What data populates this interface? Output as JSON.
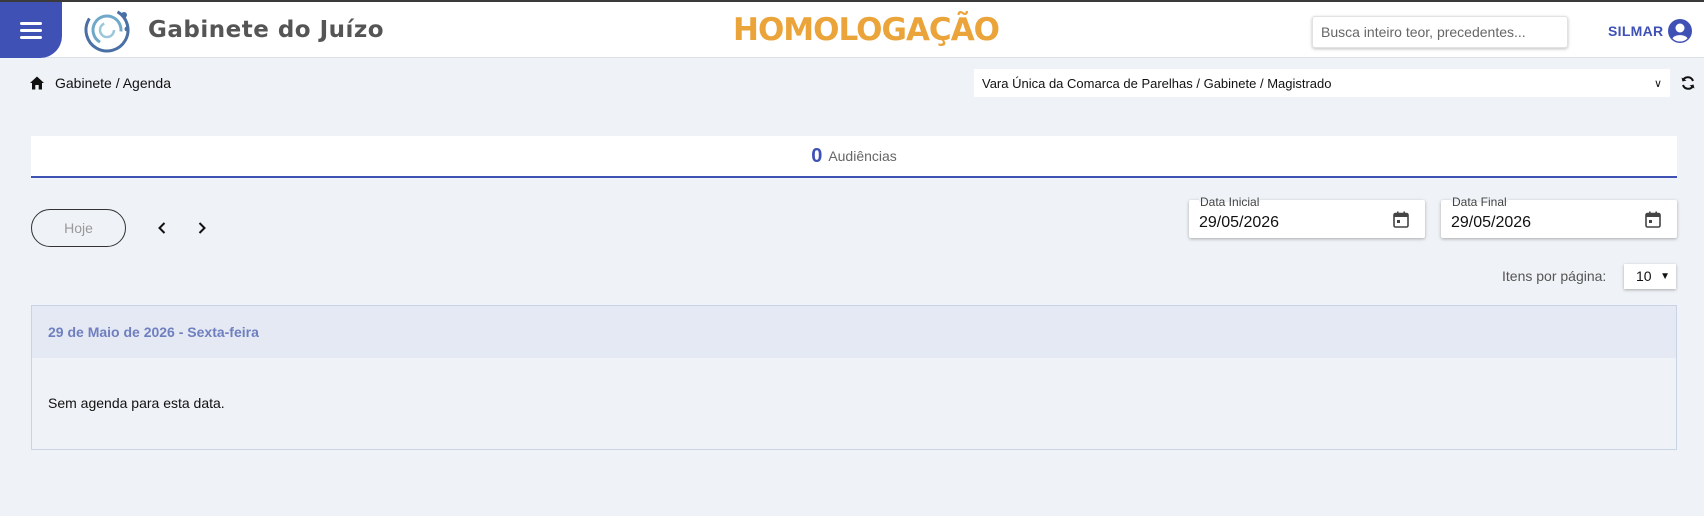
{
  "header": {
    "brand": "Gabinete do Juízo",
    "environment": "HOMOLOGAÇÃO",
    "search_placeholder": "Busca inteiro teor, precedentes...",
    "user_name": "SILMAR"
  },
  "breadcrumb": {
    "text": "Gabinete / Agenda"
  },
  "unit_selector": {
    "selected": "Vara Única da Comarca de Parelhas / Gabinete / Magistrado"
  },
  "tabs": {
    "count": "0",
    "label": "Audiências"
  },
  "controls": {
    "today_label": "Hoje",
    "start_date_label": "Data Inicial",
    "start_date_value": "29/05/2026",
    "end_date_label": "Data Final",
    "end_date_value": "29/05/2026",
    "items_per_page_label": "Itens por página:",
    "items_per_page_value": "10"
  },
  "agenda": {
    "date_heading": "29 de Maio de 2026 - Sexta-feira",
    "empty_message": "Sem agenda para esta data."
  },
  "colors": {
    "primary": "#3f51b5",
    "environment": "#eaa43a",
    "background": "#eff2f6"
  }
}
